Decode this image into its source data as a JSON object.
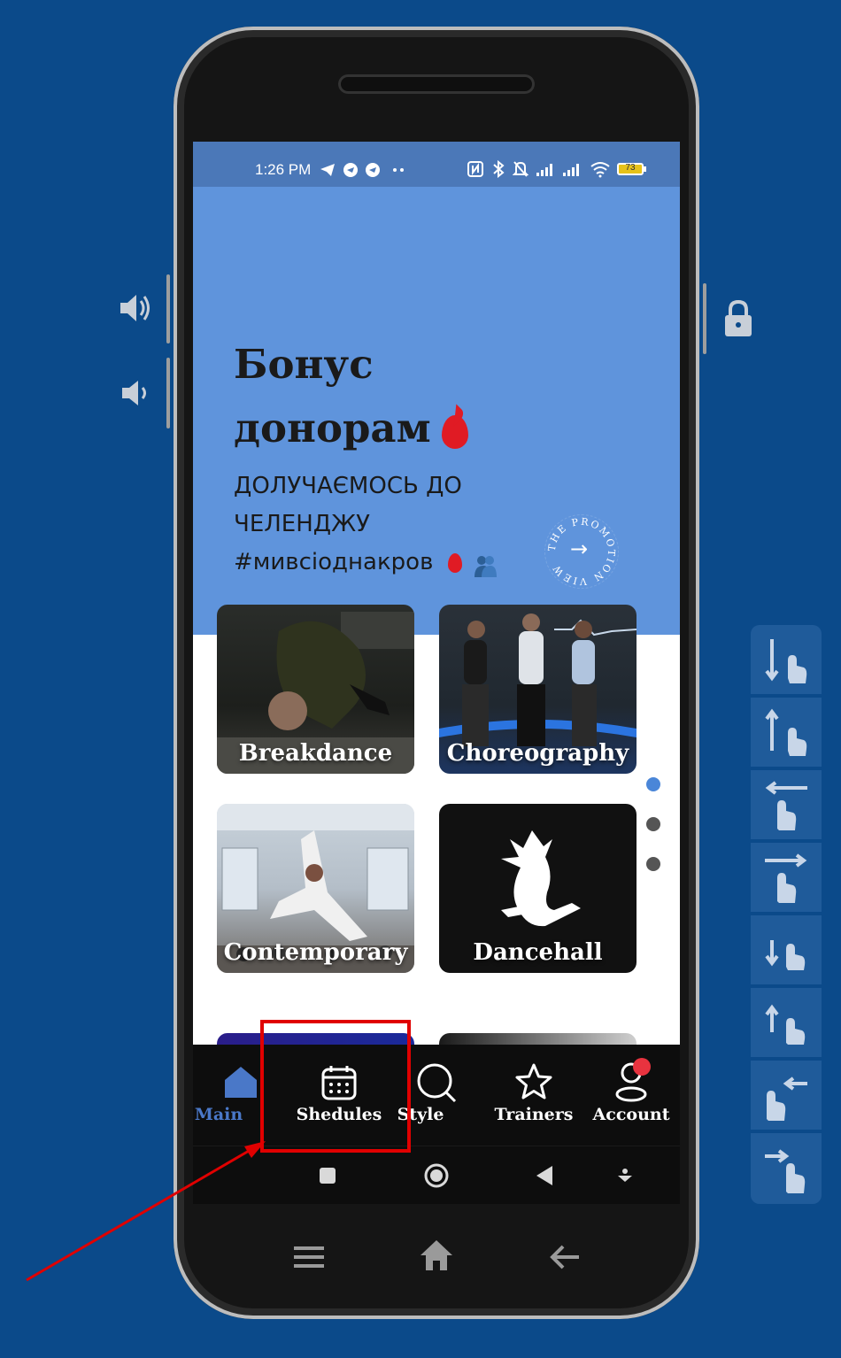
{
  "status_bar": {
    "time": "1:26 PM",
    "icons": [
      "telegram-icon",
      "chat-icon",
      "chat-icon",
      "more-icon",
      "nfc-icon",
      "bluetooth-icon",
      "mute-icon",
      "signal-icon",
      "signal-icon",
      "wifi-icon",
      "battery-icon"
    ],
    "battery": "73"
  },
  "banner": {
    "title_line1": "Бонус",
    "title_line2": "донорам",
    "subtitle_line1": "ДОЛУЧАЄМОСЬ ДО",
    "subtitle_line2": "ЧЕЛЕНДЖУ",
    "subtitle_line3": "#мивсіоднакров",
    "promo_text": "THE PROMOTION VIEW",
    "background_color": "#5f94dc"
  },
  "categories": [
    {
      "label": "Breakdance"
    },
    {
      "label": "Choreography"
    },
    {
      "label": "Contemporary"
    },
    {
      "label": "Dancehall"
    }
  ],
  "page_indicator": {
    "active": 0,
    "count": 3
  },
  "tabs": [
    {
      "label": "Main",
      "icon": "home-icon",
      "active": true
    },
    {
      "label": "Shedules",
      "icon": "calendar-icon",
      "active": false
    },
    {
      "label": "Style",
      "icon": "search-icon",
      "active": false
    },
    {
      "label": "Trainers",
      "icon": "star-icon",
      "active": false
    },
    {
      "label": "Account",
      "icon": "account-icon",
      "active": false,
      "badge": true
    }
  ],
  "colors": {
    "accent": "#5f94dc",
    "tab_active": "#4a78c8",
    "badge": "#e8333f",
    "highlight": "#e00000"
  }
}
